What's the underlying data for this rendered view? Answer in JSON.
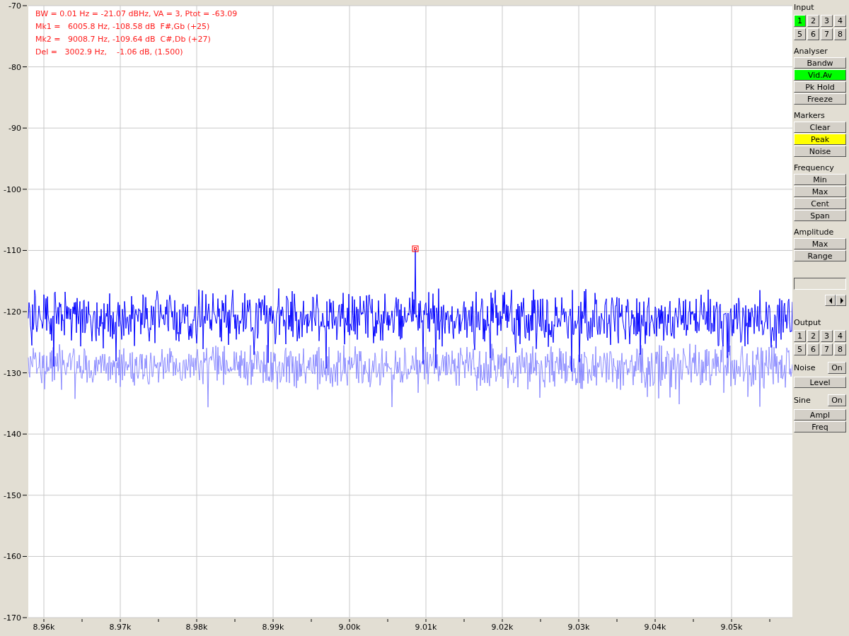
{
  "plot": {
    "readout": [
      "BW = 0.01 Hz = -21.07 dBHz, VA = 3, Ptot = -63.09",
      "Mk1 =   6005.8 Hz, -108.58 dB  F#,Gb (+25)",
      "Mk2 =   9008.7 Hz, -109.64 dB  C#,Db (+27)",
      "Del =   3002.9 Hz,    -1.06 dB, (1.500)"
    ],
    "y_tick_labels": [
      "-70",
      "-80",
      "-90",
      "-100",
      "-110",
      "-120",
      "-130",
      "-140",
      "-150",
      "-160",
      "-170"
    ],
    "x_tick_labels": [
      "8.96k",
      "8.97k",
      "8.98k",
      "8.99k",
      "9.00k",
      "9.01k",
      "9.02k",
      "9.03k",
      "9.04k",
      "9.05k"
    ]
  },
  "panel": [
    {
      "kind": "grid",
      "title": "Input",
      "buttons": [
        {
          "label": "1",
          "selected": true
        },
        {
          "label": "2",
          "selected": false
        },
        {
          "label": "3",
          "selected": false
        },
        {
          "label": "4",
          "selected": false
        },
        {
          "label": "5",
          "selected": false
        },
        {
          "label": "6",
          "selected": false
        },
        {
          "label": "7",
          "selected": false
        },
        {
          "label": "8",
          "selected": false
        }
      ]
    },
    {
      "kind": "list",
      "title": "Analyser",
      "buttons": [
        {
          "label": "Bandw",
          "on": false
        },
        {
          "label": "Vid.Av",
          "on": true,
          "color": "#00ff00"
        },
        {
          "label": "Pk Hold",
          "on": false
        },
        {
          "label": "Freeze",
          "on": false
        }
      ]
    },
    {
      "kind": "list",
      "title": "Markers",
      "buttons": [
        {
          "label": "Clear",
          "on": false
        },
        {
          "label": "Peak",
          "on": true,
          "color": "#ffff00"
        },
        {
          "label": "Noise",
          "on": false
        }
      ]
    },
    {
      "kind": "list",
      "title": "Frequency",
      "buttons": [
        {
          "label": "Min",
          "on": false
        },
        {
          "label": "Max",
          "on": false
        },
        {
          "label": "Cent",
          "on": false
        },
        {
          "label": "Span",
          "on": false
        }
      ]
    },
    {
      "kind": "list",
      "title": "Amplitude",
      "buttons": [
        {
          "label": "Max",
          "on": false
        },
        {
          "label": "Range",
          "on": false
        }
      ]
    },
    {
      "kind": "field"
    },
    {
      "kind": "grid",
      "title": "Output",
      "buttons": [
        {
          "label": "1",
          "selected": false
        },
        {
          "label": "2",
          "selected": false
        },
        {
          "label": "3",
          "selected": false
        },
        {
          "label": "4",
          "selected": false
        },
        {
          "label": "5",
          "selected": false
        },
        {
          "label": "6",
          "selected": false
        },
        {
          "label": "7",
          "selected": false
        },
        {
          "label": "8",
          "selected": false
        }
      ]
    },
    {
      "kind": "toggle",
      "title": "Noise",
      "switch": "On",
      "buttons": [
        {
          "label": "Level",
          "on": false
        }
      ]
    },
    {
      "kind": "toggle",
      "title": "Sine",
      "switch": "On",
      "buttons": [
        {
          "label": "Ampl",
          "on": false
        },
        {
          "label": "Freq",
          "on": false
        }
      ]
    }
  ]
}
